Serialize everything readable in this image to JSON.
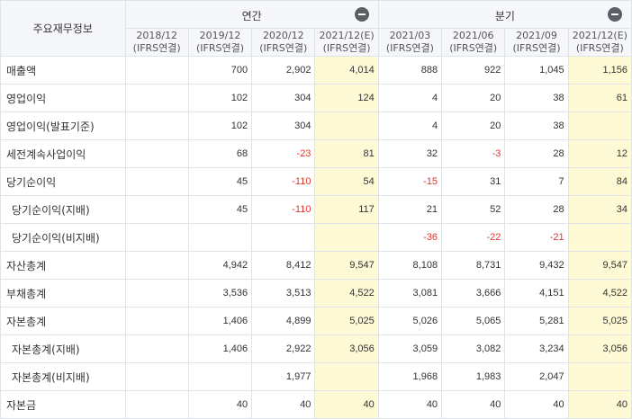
{
  "table": {
    "corner_label": "주요재무정보",
    "groups": [
      {
        "label": "연간",
        "collapse_icon": "minus-icon"
      },
      {
        "label": "분기",
        "collapse_icon": "minus-icon"
      }
    ],
    "columns": [
      {
        "period": "2018/12",
        "basis": "(IFRS연결)",
        "estimate": false
      },
      {
        "period": "2019/12",
        "basis": "(IFRS연결)",
        "estimate": false
      },
      {
        "period": "2020/12",
        "basis": "(IFRS연결)",
        "estimate": false
      },
      {
        "period": "2021/12(E)",
        "basis": "(IFRS연결)",
        "estimate": true
      },
      {
        "period": "2021/03",
        "basis": "(IFRS연결)",
        "estimate": false
      },
      {
        "period": "2021/06",
        "basis": "(IFRS연결)",
        "estimate": false
      },
      {
        "period": "2021/09",
        "basis": "(IFRS연결)",
        "estimate": false
      },
      {
        "period": "2021/12(E)",
        "basis": "(IFRS연결)",
        "estimate": true
      }
    ],
    "rows": [
      {
        "label": "매출액",
        "indent": false,
        "values": [
          "",
          "700",
          "2,902",
          "4,014",
          "888",
          "922",
          "1,045",
          "1,156"
        ]
      },
      {
        "label": "영업이익",
        "indent": false,
        "values": [
          "",
          "102",
          "304",
          "124",
          "4",
          "20",
          "38",
          "61"
        ]
      },
      {
        "label": "영업이익(발표기준)",
        "indent": false,
        "values": [
          "",
          "102",
          "304",
          "",
          "4",
          "20",
          "38",
          ""
        ]
      },
      {
        "label": "세전계속사업이익",
        "indent": false,
        "values": [
          "",
          "68",
          "-23",
          "81",
          "32",
          "-3",
          "28",
          "12"
        ]
      },
      {
        "label": "당기순이익",
        "indent": false,
        "values": [
          "",
          "45",
          "-110",
          "54",
          "-15",
          "31",
          "7",
          "84"
        ]
      },
      {
        "label": "당기순이익(지배)",
        "indent": true,
        "values": [
          "",
          "45",
          "-110",
          "117",
          "21",
          "52",
          "28",
          "34"
        ]
      },
      {
        "label": "당기순이익(비지배)",
        "indent": true,
        "values": [
          "",
          "",
          "",
          "",
          "-36",
          "-22",
          "-21",
          ""
        ]
      },
      {
        "label": "자산총계",
        "indent": false,
        "values": [
          "",
          "4,942",
          "8,412",
          "9,547",
          "8,108",
          "8,731",
          "9,432",
          "9,547"
        ]
      },
      {
        "label": "부채총계",
        "indent": false,
        "values": [
          "",
          "3,536",
          "3,513",
          "4,522",
          "3,081",
          "3,666",
          "4,151",
          "4,522"
        ]
      },
      {
        "label": "자본총계",
        "indent": false,
        "values": [
          "",
          "1,406",
          "4,899",
          "5,025",
          "5,026",
          "5,065",
          "5,281",
          "5,025"
        ]
      },
      {
        "label": "자본총계(지배)",
        "indent": true,
        "values": [
          "",
          "1,406",
          "2,922",
          "3,056",
          "3,059",
          "3,082",
          "3,234",
          "3,056"
        ]
      },
      {
        "label": "자본총계(비지배)",
        "indent": true,
        "values": [
          "",
          "",
          "1,977",
          "",
          "1,968",
          "1,983",
          "2,047",
          ""
        ]
      },
      {
        "label": "자본금",
        "indent": false,
        "values": [
          "",
          "40",
          "40",
          "40",
          "40",
          "40",
          "40",
          "40"
        ]
      }
    ],
    "colors": {
      "negative": "#e0372e",
      "estimate_bg": "#fffad6",
      "header_bg": "#f5f7fb",
      "border": "#dfe3ea"
    }
  }
}
